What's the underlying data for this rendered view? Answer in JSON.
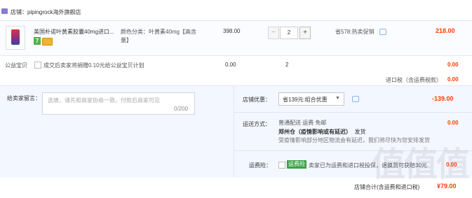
{
  "store": {
    "label": "店铺：pipingrock海外旗舰店",
    "icon": "store-icon"
  },
  "item": {
    "title": "美国朴诺叶黄素胶囊40mg进口...",
    "badge_number": "7",
    "spec": "颜色分类：叶黄素40mg【高含量】",
    "unit_price": "398.00",
    "quantity": "2",
    "minus_label": "−",
    "plus_label": "+",
    "promo": "省578:热卖促销",
    "total": "218.00"
  },
  "charity": {
    "label": "公益宝贝",
    "text": "成交后卖家将捐赠0.10元给公益宝贝计划",
    "price": "0.00",
    "qty": "2",
    "total": "0.00"
  },
  "tax": {
    "label": "进口税（含运费税款）",
    "value": "0.00"
  },
  "message": {
    "label": "给卖家留言：",
    "placeholder": "选填，请先和商家协商一致，付款后商家可见",
    "count": "0/200"
  },
  "discount": {
    "label": "店铺优惠：",
    "selected": "省139元:组合优惠",
    "value": "-139.00"
  },
  "shipping": {
    "label": "运送方式：",
    "line1": "普通配送 运费 免邮",
    "warehouse": "郑州仓（疫情影响或有延迟）",
    "ship_word": "发货",
    "line3": "受疫情影响部分地区物流会有延迟，我们将尽快为您安排发货",
    "value": "0.00"
  },
  "fee": {
    "label": "运费险：",
    "tag": "运费险",
    "text": "卖家已为运费和进口税投保，退换货可获赔30元",
    "value": "0.00"
  },
  "total": {
    "label": "店铺合计(含运费和进口税)",
    "value": "¥79.00"
  },
  "watermark": "值值值",
  "colors": {
    "accent": "#ff3d00",
    "store_icon": "#8a7bd1",
    "panel_bg": "#f3f7ff",
    "fee_tag": "#3aa346",
    "badge_green": "#55b04b"
  }
}
